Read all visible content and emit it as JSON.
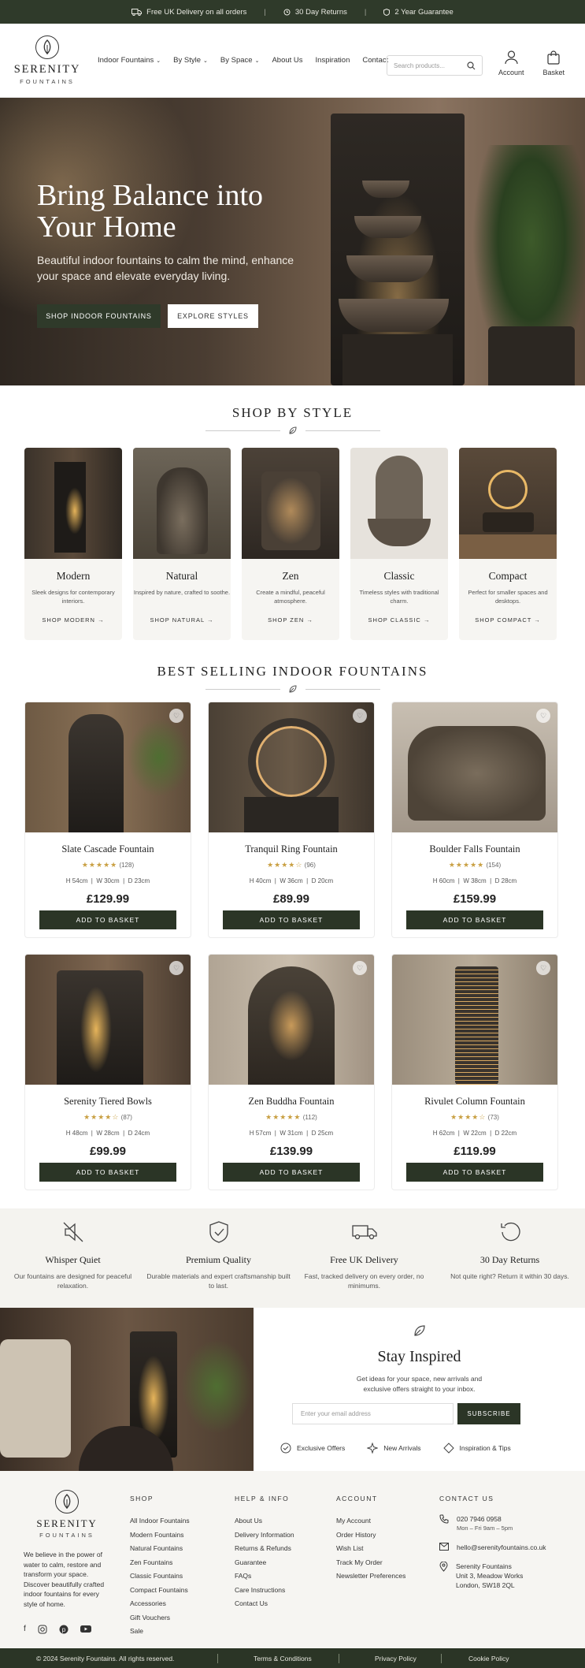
{
  "topbar": {
    "delivery": "Free UK Delivery on all orders",
    "returns": "30 Day Returns",
    "guarantee": "2 Year Guarantee"
  },
  "brand": {
    "name": "SERENITY",
    "tagline": "FOUNTAINS"
  },
  "nav": {
    "items": [
      "Indoor Fountains",
      "By Style",
      "By Space",
      "About Us",
      "Inspiration",
      "Contact"
    ]
  },
  "search": {
    "placeholder": "Search products..."
  },
  "header_icons": {
    "account": "Account",
    "basket": "Basket"
  },
  "hero": {
    "title": "Bring Balance into Your Home",
    "subtitle": "Beautiful indoor fountains to calm the mind, enhance your space and elevate everyday living.",
    "primary_cta": "SHOP INDOOR FOUNTAINS",
    "secondary_cta": "EXPLORE STYLES"
  },
  "shop_by_style": {
    "title": "SHOP BY STYLE",
    "cards": [
      {
        "name": "Modern",
        "desc": "Sleek designs for contemporary interiors.",
        "cta": "SHOP MODERN"
      },
      {
        "name": "Natural",
        "desc": "Inspired by nature, crafted to soothe.",
        "cta": "SHOP NATURAL"
      },
      {
        "name": "Zen",
        "desc": "Create a mindful, peaceful atmosphere.",
        "cta": "SHOP ZEN"
      },
      {
        "name": "Classic",
        "desc": "Timeless styles with traditional charm.",
        "cta": "SHOP CLASSIC"
      },
      {
        "name": "Compact",
        "desc": "Perfect for smaller spaces and desktops.",
        "cta": "SHOP COMPACT"
      }
    ]
  },
  "best_sellers": {
    "title": "BEST SELLING INDOOR FOUNTAINS",
    "add_label": "ADD TO BASKET",
    "products": [
      {
        "name": "Slate Cascade Fountain",
        "rating": 4.5,
        "stars": "★★★★★",
        "reviews": "(128)",
        "h": "H 54cm",
        "w": "W 30cm",
        "d": "D 23cm",
        "price": "£129.99"
      },
      {
        "name": "Tranquil Ring Fountain",
        "rating": 4.5,
        "stars": "★★★★☆",
        "reviews": "(96)",
        "h": "H 40cm",
        "w": "W 36cm",
        "d": "D 20cm",
        "price": "£89.99"
      },
      {
        "name": "Boulder Falls Fountain",
        "rating": 4.5,
        "stars": "★★★★★",
        "reviews": "(154)",
        "h": "H 60cm",
        "w": "W 38cm",
        "d": "D 28cm",
        "price": "£159.99"
      },
      {
        "name": "Serenity Tiered Bowls",
        "rating": 4.5,
        "stars": "★★★★☆",
        "reviews": "(87)",
        "h": "H 48cm",
        "w": "W 28cm",
        "d": "D 24cm",
        "price": "£99.99"
      },
      {
        "name": "Zen Buddha Fountain",
        "rating": 4.5,
        "stars": "★★★★★",
        "reviews": "(112)",
        "h": "H 57cm",
        "w": "W 31cm",
        "d": "D 25cm",
        "price": "£139.99"
      },
      {
        "name": "Rivulet Column Fountain",
        "rating": 4.5,
        "stars": "★★★★☆",
        "reviews": "(73)",
        "h": "H 62cm",
        "w": "W 22cm",
        "d": "D 22cm",
        "price": "£119.99"
      }
    ]
  },
  "features": [
    {
      "name": "Whisper Quiet",
      "desc": "Our fountains are designed for peaceful relaxation.",
      "icon": "mute-speaker-icon"
    },
    {
      "name": "Premium Quality",
      "desc": "Durable materials and expert craftsmanship built to last.",
      "icon": "shield-check-icon"
    },
    {
      "name": "Free UK Delivery",
      "desc": "Fast, tracked delivery on every order, no minimums.",
      "icon": "truck-icon"
    },
    {
      "name": "30 Day Returns",
      "desc": "Not quite right? Return it within 30 days.",
      "icon": "return-arrow-icon"
    }
  ],
  "newsletter": {
    "title": "Stay Inspired",
    "text": "Get ideas for your space, new arrivals and exclusive offers straight to your inbox.",
    "placeholder": "Enter your email address",
    "button": "SUBSCRIBE",
    "perks": [
      "Exclusive Offers",
      "New Arrivals",
      "Inspiration & Tips"
    ]
  },
  "footer": {
    "about": "We believe in the power of water to calm, restore and transform your space. Discover beautifully crafted indoor fountains for every style of home.",
    "shop": {
      "title": "SHOP",
      "links": [
        "All Indoor Fountains",
        "Modern Fountains",
        "Natural Fountains",
        "Zen Fountains",
        "Classic Fountains",
        "Compact Fountains",
        "Accessories",
        "Gift Vouchers",
        "Sale"
      ]
    },
    "help": {
      "title": "HELP & INFO",
      "links": [
        "About Us",
        "Delivery Information",
        "Returns & Refunds",
        "Guarantee",
        "FAQs",
        "Care Instructions",
        "Contact Us"
      ]
    },
    "account": {
      "title": "ACCOUNT",
      "links": [
        "My Account",
        "Order History",
        "Wish List",
        "Track My Order",
        "Newsletter Preferences"
      ]
    },
    "contact": {
      "title": "CONTACT US",
      "phone": "020 7946 0958",
      "hours": "Mon – Fri 9am – 5pm",
      "email": "hello@serenityfountains.co.uk",
      "address1": "Serenity Fountains",
      "address2": "Unit 3, Meadow Works",
      "address3": "London, SW18 2QL"
    }
  },
  "bottom": {
    "copyright": "© 2024 Serenity Fountains. All rights reserved.",
    "terms": "Terms & Conditions",
    "privacy": "Privacy Policy",
    "cookie": "Cookie Policy"
  },
  "colors": {
    "accent": "#2f3a2a",
    "star": "#c9a043",
    "cream": "#f6f5f2"
  }
}
